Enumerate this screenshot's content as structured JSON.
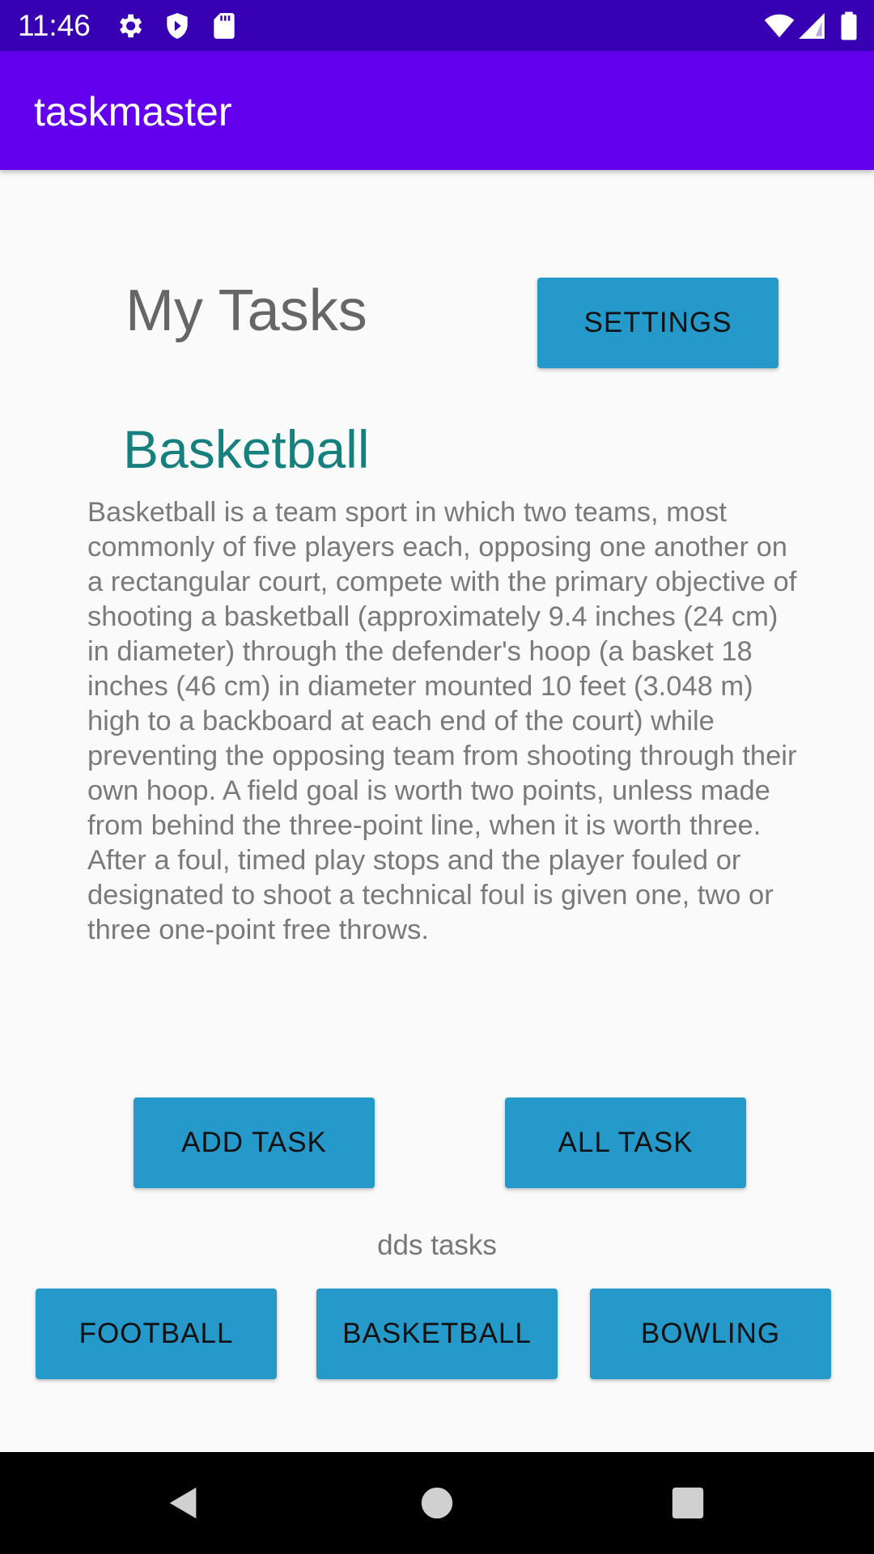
{
  "status_bar": {
    "time": "11:46",
    "icons": [
      "gear-icon",
      "shield-icon",
      "sd-card-icon",
      "wifi-icon",
      "signal-icon",
      "battery-icon"
    ]
  },
  "app_bar": {
    "title": "taskmaster",
    "color": "#6200ee"
  },
  "main": {
    "title": "My Tasks",
    "settings_label": "SETTINGS",
    "task": {
      "title": "Basketball",
      "description": "Basketball is a team sport in which two teams, most commonly of five players each, opposing one another on a rectangular court, compete with the primary objective of shooting a basketball (approximately 9.4 inches (24 cm) in diameter) through the defender's hoop (a basket 18 inches (46 cm) in diameter mounted 10 feet (3.048 m) high to a backboard at each end of the court) while preventing the opposing team from shooting through their own hoop. A field goal is worth two points, unless made from behind the three-point line, when it is worth three. After a foul, timed play stops and the player fouled or designated to shoot a technical foul is given one, two or three one-point free throws."
    },
    "actions": {
      "add_task": "ADD TASK",
      "all_task": "ALL TASK"
    },
    "section_label": "dds tasks",
    "quick_tasks": [
      "FOOTBALL",
      "BASKETBALL",
      "BOWLING"
    ]
  },
  "colors": {
    "button": "#2599c9",
    "task_title": "#16807f",
    "status_bar": "#3700b3"
  },
  "nav_bar": {
    "icons": [
      "back-icon",
      "home-icon",
      "recents-icon"
    ]
  }
}
